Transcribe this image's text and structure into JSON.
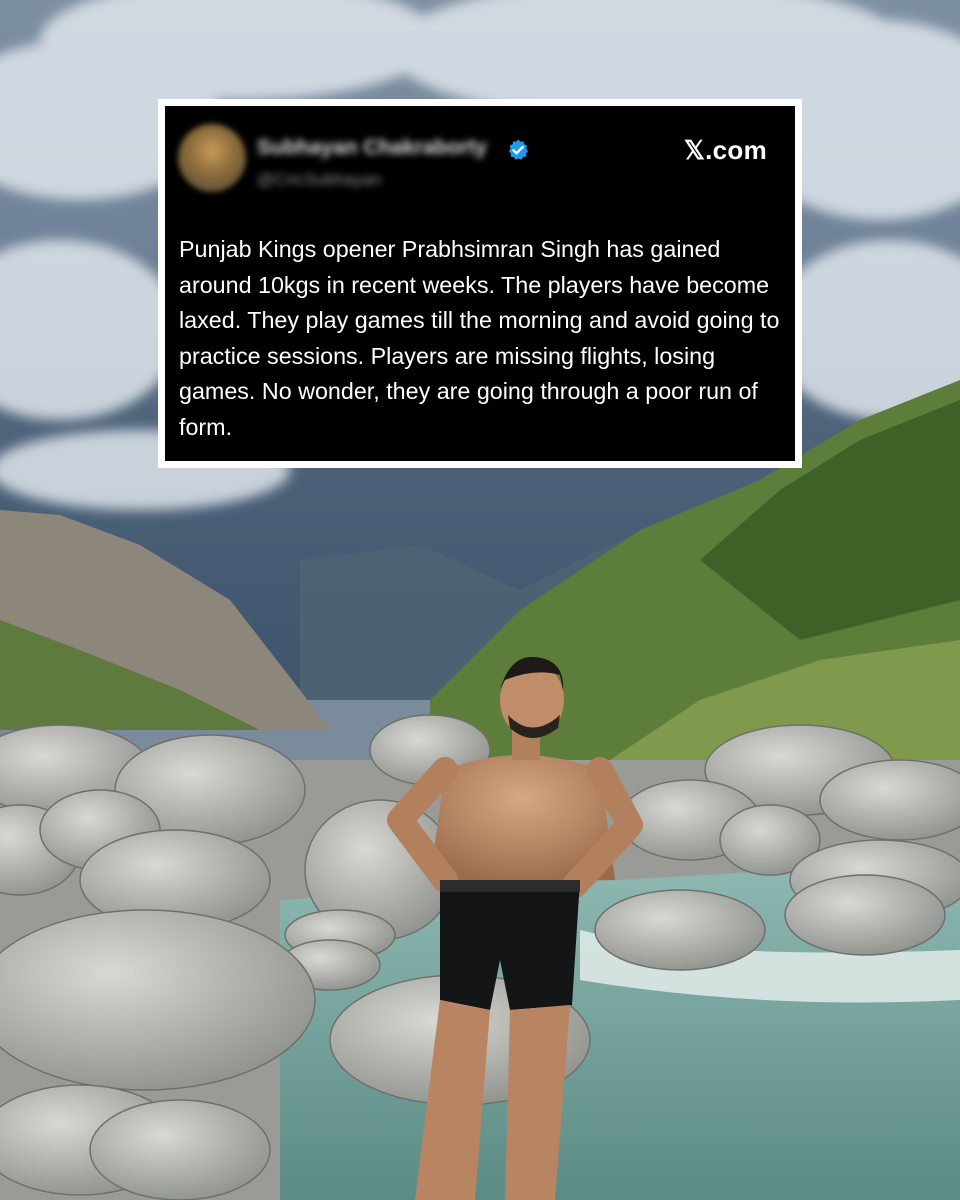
{
  "post": {
    "author_name": "Subhayan Chakraborty",
    "author_handle": "@CricSubhayan",
    "verified_icon": "verified-badge-icon",
    "brand": "𝕏.com",
    "text": "Punjab Kings opener Prabhsimran Singh has gained around 10kgs in recent weeks. The players have become laxed. They play games till the morning and avoid going to practice sessions. Players are missing flights, losing games. No wonder, they are going through a poor run of form."
  },
  "colors": {
    "card_background": "#000000",
    "card_border": "#ffffff",
    "verified_blue": "#1d9bf0",
    "text": "#ffffff"
  }
}
